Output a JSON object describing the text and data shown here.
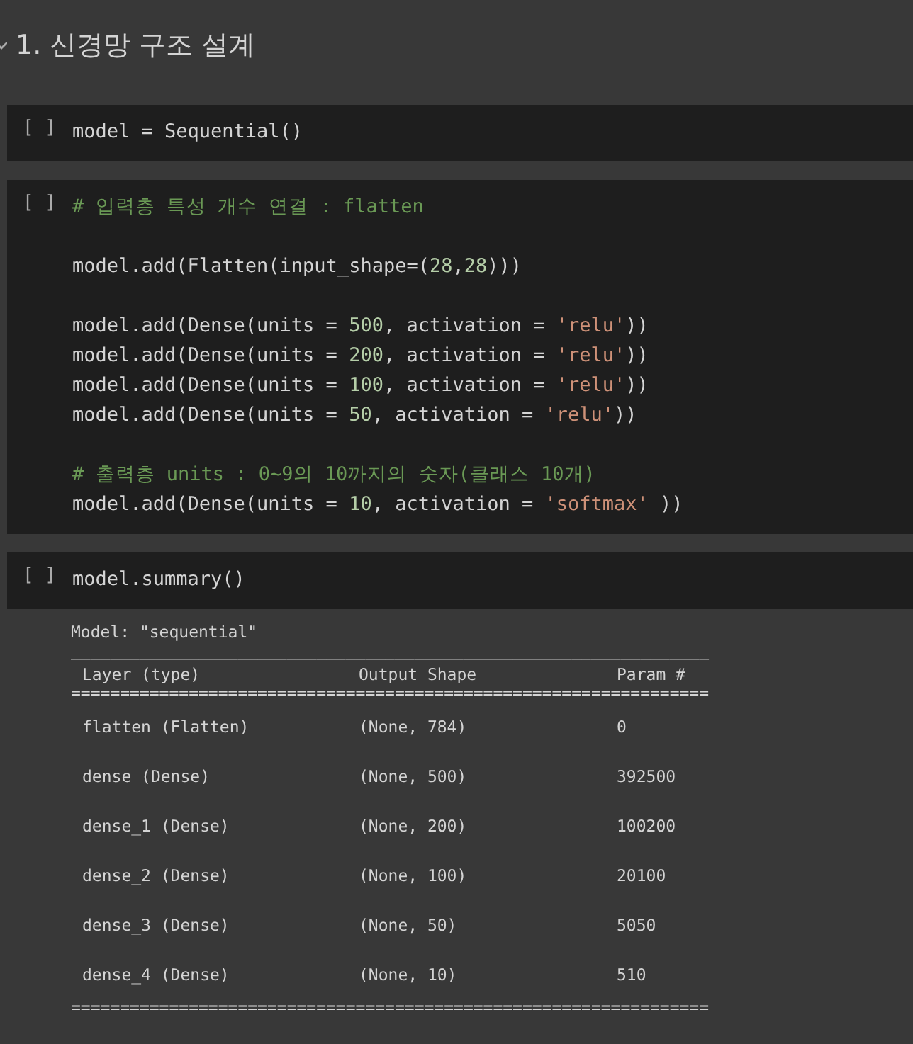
{
  "heading": {
    "text": "1. 신경망 구조 설계",
    "expanded": true
  },
  "cells": [
    {
      "run_label": "[ ]",
      "lines": [
        {
          "kind": "code",
          "tokens": [
            {
              "kind": "plain",
              "text": "model = Sequential()"
            }
          ]
        }
      ]
    },
    {
      "run_label": "[ ]",
      "lines": [
        {
          "kind": "code",
          "tokens": [
            {
              "kind": "comment",
              "text": "# 입력층 특성 개수 연결 : flatten"
            }
          ]
        },
        {
          "kind": "blank"
        },
        {
          "kind": "code",
          "tokens": [
            {
              "kind": "plain",
              "text": "model.add(Flatten(input_shape=("
            },
            {
              "kind": "number",
              "text": "28"
            },
            {
              "kind": "plain",
              "text": ","
            },
            {
              "kind": "number",
              "text": "28"
            },
            {
              "kind": "plain",
              "text": ")))"
            }
          ]
        },
        {
          "kind": "blank"
        },
        {
          "kind": "code",
          "tokens": [
            {
              "kind": "plain",
              "text": "model.add(Dense(units = "
            },
            {
              "kind": "number",
              "text": "500"
            },
            {
              "kind": "plain",
              "text": ", activation = "
            },
            {
              "kind": "string",
              "text": "'relu'"
            },
            {
              "kind": "plain",
              "text": "))"
            }
          ]
        },
        {
          "kind": "code",
          "tokens": [
            {
              "kind": "plain",
              "text": "model.add(Dense(units = "
            },
            {
              "kind": "number",
              "text": "200"
            },
            {
              "kind": "plain",
              "text": ", activation = "
            },
            {
              "kind": "string",
              "text": "'relu'"
            },
            {
              "kind": "plain",
              "text": "))"
            }
          ]
        },
        {
          "kind": "code",
          "tokens": [
            {
              "kind": "plain",
              "text": "model.add(Dense(units = "
            },
            {
              "kind": "number",
              "text": "100"
            },
            {
              "kind": "plain",
              "text": ", activation = "
            },
            {
              "kind": "string",
              "text": "'relu'"
            },
            {
              "kind": "plain",
              "text": "))"
            }
          ]
        },
        {
          "kind": "code",
          "tokens": [
            {
              "kind": "plain",
              "text": "model.add(Dense(units = "
            },
            {
              "kind": "number",
              "text": "50"
            },
            {
              "kind": "plain",
              "text": ", activation = "
            },
            {
              "kind": "string",
              "text": "'relu'"
            },
            {
              "kind": "plain",
              "text": "))"
            }
          ]
        },
        {
          "kind": "blank"
        },
        {
          "kind": "code",
          "tokens": [
            {
              "kind": "comment",
              "text": "# 출력층 units : 0~9의 10까지의 숫자(클래스 10개)"
            }
          ]
        },
        {
          "kind": "code",
          "tokens": [
            {
              "kind": "plain",
              "text": "model.add(Dense(units = "
            },
            {
              "kind": "number",
              "text": "10"
            },
            {
              "kind": "plain",
              "text": ", activation = "
            },
            {
              "kind": "string",
              "text": "'softmax'"
            },
            {
              "kind": "plain",
              "text": " ))"
            }
          ]
        }
      ]
    },
    {
      "run_label": "[ ]",
      "lines": [
        {
          "kind": "code",
          "tokens": [
            {
              "kind": "plain",
              "text": "model.summary()"
            }
          ]
        }
      ],
      "output": {
        "model_line": "Model: \"sequential\"",
        "rule_top": "_________________________________________________________________",
        "columns": [
          "Layer (type)",
          "Output Shape",
          "Param #"
        ],
        "rule_header": "=================================================================",
        "rows": [
          [
            "flatten (Flatten)",
            "(None, 784)",
            "0"
          ],
          [
            "dense (Dense)",
            "(None, 500)",
            "392500"
          ],
          [
            "dense_1 (Dense)",
            "(None, 200)",
            "100200"
          ],
          [
            "dense_2 (Dense)",
            "(None, 100)",
            "20100"
          ],
          [
            "dense_3 (Dense)",
            "(None, 50)",
            "5050"
          ],
          [
            "dense_4 (Dense)",
            "(None, 10)",
            "510"
          ]
        ],
        "rule_bottom": "================================================================="
      }
    }
  ]
}
